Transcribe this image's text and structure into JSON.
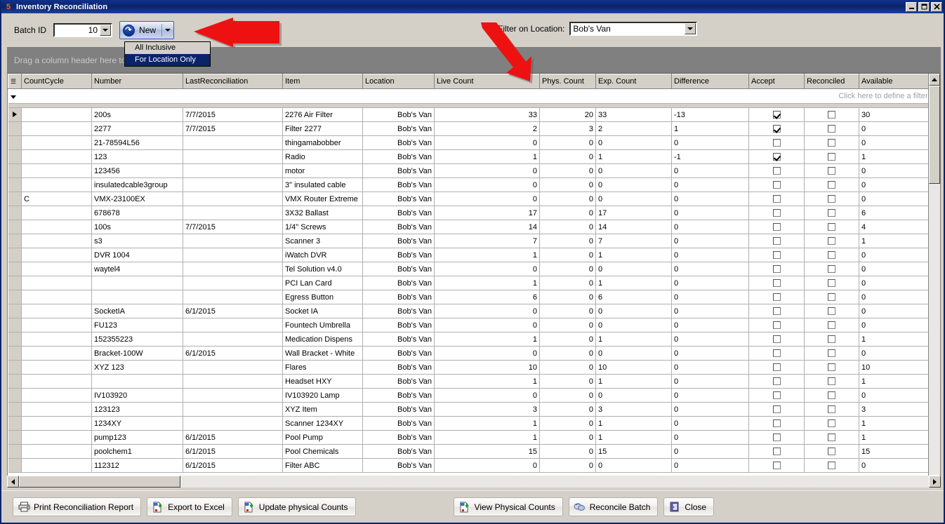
{
  "window": {
    "title": "Inventory Reconciliation",
    "icon": "app-icon",
    "minimize_label": "_",
    "maximize_label": "□",
    "close_label": "✕"
  },
  "toolbar": {
    "batch_id_label": "Batch ID",
    "batch_id_value": "10",
    "new_button_label": "New",
    "new_menu": [
      {
        "label": "All Inclusive",
        "selected": false
      },
      {
        "label": "For Location Only",
        "selected": true
      }
    ],
    "filter_location_label": "Filter on Location:",
    "filter_location_value": "Bob's Van"
  },
  "grid": {
    "group_bar_text": "Drag a column header here to group by that column",
    "filter_row_text": "Click here to define a filter",
    "columns": [
      "CountCycle",
      "Number",
      "LastReconciliation",
      "Item",
      "Location",
      "Live Count",
      "Phys. Count",
      "Exp. Count",
      "Difference",
      "Accept",
      "Reconciled",
      "Available"
    ],
    "rows": [
      {
        "countcycle": "",
        "number": "200s",
        "last": "7/7/2015",
        "item": "2276 Air Filter",
        "location": "Bob's Van",
        "live": "33",
        "phys": "20",
        "exp": "33",
        "diff": "-13",
        "accept": true,
        "reconciled": false,
        "available": "30",
        "current": true
      },
      {
        "countcycle": "",
        "number": "2277",
        "last": "7/7/2015",
        "item": "Filter 2277",
        "location": "Bob's Van",
        "live": "2",
        "phys": "3",
        "exp": "2",
        "diff": "1",
        "accept": true,
        "reconciled": false,
        "available": "0",
        "current": false
      },
      {
        "countcycle": "",
        "number": "21-78594L56",
        "last": "",
        "item": "thingamabobber",
        "location": "Bob's Van",
        "live": "0",
        "phys": "0",
        "exp": "0",
        "diff": "0",
        "accept": false,
        "reconciled": false,
        "available": "0",
        "current": false
      },
      {
        "countcycle": "",
        "number": "123",
        "last": "",
        "item": "Radio",
        "location": "Bob's Van",
        "live": "1",
        "phys": "0",
        "exp": "1",
        "diff": "-1",
        "accept": true,
        "reconciled": false,
        "available": "1",
        "current": false
      },
      {
        "countcycle": "",
        "number": "123456",
        "last": "",
        "item": "motor",
        "location": "Bob's Van",
        "live": "0",
        "phys": "0",
        "exp": "0",
        "diff": "0",
        "accept": false,
        "reconciled": false,
        "available": "0",
        "current": false
      },
      {
        "countcycle": "",
        "number": "insulatedcable3group",
        "last": "",
        "item": "3\" insulated cable",
        "location": "Bob's Van",
        "live": "0",
        "phys": "0",
        "exp": "0",
        "diff": "0",
        "accept": false,
        "reconciled": false,
        "available": "0",
        "current": false
      },
      {
        "countcycle": "C",
        "number": "VMX-23100EX",
        "last": "",
        "item": "VMX Router Extreme",
        "location": "Bob's Van",
        "live": "0",
        "phys": "0",
        "exp": "0",
        "diff": "0",
        "accept": false,
        "reconciled": false,
        "available": "0",
        "current": false
      },
      {
        "countcycle": "",
        "number": "678678",
        "last": "",
        "item": "3X32 Ballast",
        "location": "Bob's Van",
        "live": "17",
        "phys": "0",
        "exp": "17",
        "diff": "0",
        "accept": false,
        "reconciled": false,
        "available": "6",
        "current": false
      },
      {
        "countcycle": "",
        "number": "100s",
        "last": "7/7/2015",
        "item": "1/4\" Screws",
        "location": "Bob's Van",
        "live": "14",
        "phys": "0",
        "exp": "14",
        "diff": "0",
        "accept": false,
        "reconciled": false,
        "available": "4",
        "current": false
      },
      {
        "countcycle": "",
        "number": "s3",
        "last": "",
        "item": "Scanner 3",
        "location": "Bob's Van",
        "live": "7",
        "phys": "0",
        "exp": "7",
        "diff": "0",
        "accept": false,
        "reconciled": false,
        "available": "1",
        "current": false
      },
      {
        "countcycle": "",
        "number": "DVR 1004",
        "last": "",
        "item": "iWatch DVR",
        "location": "Bob's Van",
        "live": "1",
        "phys": "0",
        "exp": "1",
        "diff": "0",
        "accept": false,
        "reconciled": false,
        "available": "0",
        "current": false
      },
      {
        "countcycle": "",
        "number": "waytel4",
        "last": "",
        "item": "Tel  Solution v4.0",
        "location": "Bob's Van",
        "live": "0",
        "phys": "0",
        "exp": "0",
        "diff": "0",
        "accept": false,
        "reconciled": false,
        "available": "0",
        "current": false
      },
      {
        "countcycle": "",
        "number": "",
        "last": "",
        "item": "PCI Lan Card",
        "location": "Bob's Van",
        "live": "1",
        "phys": "0",
        "exp": "1",
        "diff": "0",
        "accept": false,
        "reconciled": false,
        "available": "0",
        "current": false
      },
      {
        "countcycle": "",
        "number": "",
        "last": "",
        "item": "Egress Button",
        "location": "Bob's Van",
        "live": "6",
        "phys": "0",
        "exp": "6",
        "diff": "0",
        "accept": false,
        "reconciled": false,
        "available": "0",
        "current": false
      },
      {
        "countcycle": "",
        "number": "SocketIA",
        "last": "6/1/2015",
        "item": "Socket IA",
        "location": "Bob's Van",
        "live": "0",
        "phys": "0",
        "exp": "0",
        "diff": "0",
        "accept": false,
        "reconciled": false,
        "available": "0",
        "current": false
      },
      {
        "countcycle": "",
        "number": "FU123",
        "last": "",
        "item": "Fountech Umbrella",
        "location": "Bob's Van",
        "live": "0",
        "phys": "0",
        "exp": "0",
        "diff": "0",
        "accept": false,
        "reconciled": false,
        "available": "0",
        "current": false
      },
      {
        "countcycle": "",
        "number": "152355223",
        "last": "",
        "item": "Medication Dispens",
        "location": "Bob's Van",
        "live": "1",
        "phys": "0",
        "exp": "1",
        "diff": "0",
        "accept": false,
        "reconciled": false,
        "available": "1",
        "current": false
      },
      {
        "countcycle": "",
        "number": "Bracket-100W",
        "last": "6/1/2015",
        "item": "Wall Bracket - White",
        "location": "Bob's Van",
        "live": "0",
        "phys": "0",
        "exp": "0",
        "diff": "0",
        "accept": false,
        "reconciled": false,
        "available": "0",
        "current": false
      },
      {
        "countcycle": "",
        "number": "XYZ 123",
        "last": "",
        "item": "Flares",
        "location": "Bob's Van",
        "live": "10",
        "phys": "0",
        "exp": "10",
        "diff": "0",
        "accept": false,
        "reconciled": false,
        "available": "10",
        "current": false
      },
      {
        "countcycle": "",
        "number": "",
        "last": "",
        "item": "Headset HXY",
        "location": "Bob's Van",
        "live": "1",
        "phys": "0",
        "exp": "1",
        "diff": "0",
        "accept": false,
        "reconciled": false,
        "available": "1",
        "current": false
      },
      {
        "countcycle": "",
        "number": "IV103920",
        "last": "",
        "item": "IV103920 Lamp",
        "location": "Bob's Van",
        "live": "0",
        "phys": "0",
        "exp": "0",
        "diff": "0",
        "accept": false,
        "reconciled": false,
        "available": "0",
        "current": false
      },
      {
        "countcycle": "",
        "number": "123123",
        "last": "",
        "item": "XYZ Item",
        "location": "Bob's Van",
        "live": "3",
        "phys": "0",
        "exp": "3",
        "diff": "0",
        "accept": false,
        "reconciled": false,
        "available": "3",
        "current": false
      },
      {
        "countcycle": "",
        "number": "1234XY",
        "last": "",
        "item": "Scanner 1234XY",
        "location": "Bob's Van",
        "live": "1",
        "phys": "0",
        "exp": "1",
        "diff": "0",
        "accept": false,
        "reconciled": false,
        "available": "1",
        "current": false
      },
      {
        "countcycle": "",
        "number": "pump123",
        "last": "6/1/2015",
        "item": "Pool Pump",
        "location": "Bob's Van",
        "live": "1",
        "phys": "0",
        "exp": "1",
        "diff": "0",
        "accept": false,
        "reconciled": false,
        "available": "1",
        "current": false
      },
      {
        "countcycle": "",
        "number": "poolchem1",
        "last": "6/1/2015",
        "item": "Pool Chemicals",
        "location": "Bob's Van",
        "live": "15",
        "phys": "0",
        "exp": "15",
        "diff": "0",
        "accept": false,
        "reconciled": false,
        "available": "15",
        "current": false
      },
      {
        "countcycle": "",
        "number": "112312",
        "last": "6/1/2015",
        "item": "Filter ABC",
        "location": "Bob's Van",
        "live": "0",
        "phys": "0",
        "exp": "0",
        "diff": "0",
        "accept": false,
        "reconciled": false,
        "available": "0",
        "current": false
      }
    ]
  },
  "bottom_buttons": [
    {
      "label": "Print Reconciliation Report",
      "icon": "printer-icon"
    },
    {
      "label": "Export to Excel",
      "icon": "export-icon"
    },
    {
      "label": "Update physical Counts",
      "icon": "export-icon"
    },
    {
      "label": "View Physical Counts",
      "icon": "export-icon"
    },
    {
      "label": "Reconcile Batch",
      "icon": "reconcile-icon"
    },
    {
      "label": "Close",
      "icon": "door-icon"
    }
  ],
  "colors": {
    "titlebar": "#0a246a",
    "window_face": "#d4d0c8",
    "group_bar": "#808080",
    "menu_highlight": "#0a246a",
    "annotation_arrow": "#ee1111"
  }
}
